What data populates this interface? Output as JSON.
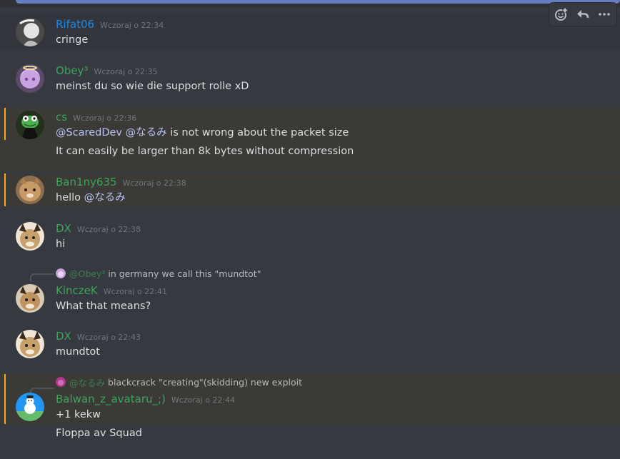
{
  "colors": {
    "background": "#36393f",
    "hover": "#32353b",
    "mention_highlight": "#3b3a36",
    "mention_bar": "#faa61a",
    "username_blue": "#1e88e5",
    "username_green": "#3ba55c",
    "text": "#dcddde",
    "timestamp": "#72767d",
    "mention_text": "#b9c4f8"
  },
  "toolbar": {
    "icons": [
      "add-reaction-icon",
      "reply-icon",
      "more-icon"
    ]
  },
  "messages": [
    {
      "username": "Rifat06",
      "timestamp": "Wczoraj o 22:34",
      "lines": [
        "cringe"
      ]
    },
    {
      "username": "Obey³",
      "timestamp": "Wczoraj o 22:35",
      "lines": [
        "meinst du so wie die support rolle xD"
      ]
    },
    {
      "username": "cs",
      "timestamp": "Wczoraj o 22:36",
      "line1": {
        "mention_a": "@ScaredDev",
        "mention_b": "@なるみ",
        "rest": "is not wrong about the packet size"
      },
      "line2": "It can easily be larger than 8k bytes without compression"
    },
    {
      "username": "Ban1ny635",
      "timestamp": "Wczoraj o 22:38",
      "text": "hello",
      "mention": "@なるみ"
    },
    {
      "username": "DX",
      "timestamp": "Wczoraj o 22:38",
      "lines": [
        "hi"
      ]
    },
    {
      "reply": {
        "name": "@Obey³",
        "text": "in germany we call this \"mundtot\""
      },
      "username": "KinczeK",
      "timestamp": "Wczoraj o 22:41",
      "lines": [
        "What that means?"
      ]
    },
    {
      "username": "DX",
      "timestamp": "Wczoraj o 22:43",
      "lines": [
        "mundtot"
      ]
    },
    {
      "reply": {
        "name": "@なるみ",
        "text": "blackcrack \"creating\"(skidding) new exploit"
      },
      "username": "Balwan_z_avataru_;)",
      "timestamp": "Wczoraj o 22:44",
      "lines": [
        "+1 kekw",
        "Floppa av Squad"
      ]
    }
  ]
}
